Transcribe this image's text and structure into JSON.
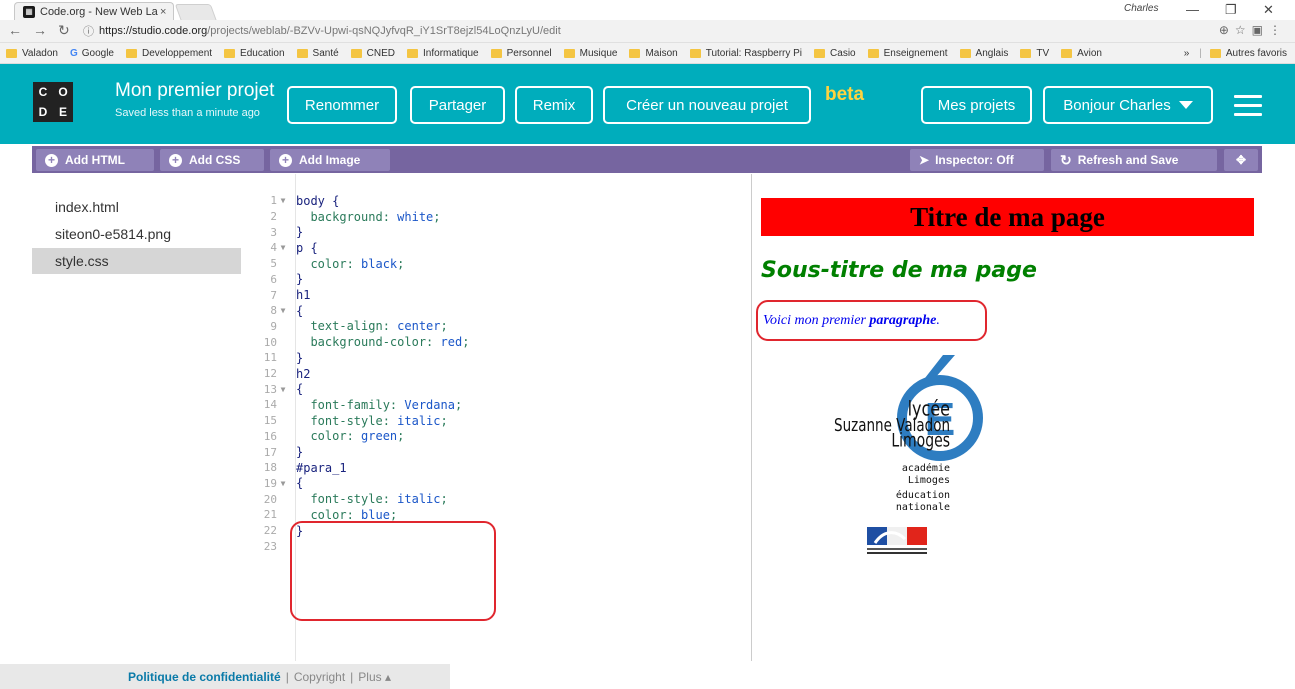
{
  "browser": {
    "tab_title": "Code.org - New Web Lab",
    "user": "Charles",
    "url_host": "https://studio.code.org",
    "url_path": "/projects/weblab/-BZVv-Upwi-qsNQJyfvqR_iY1SrT8ejzl54LoQnzLyU/edit",
    "bookmarks": [
      "Valadon",
      "Google",
      "Developpement",
      "Education",
      "Santé",
      "CNED",
      "Informatique",
      "Personnel",
      "Musique",
      "Maison",
      "Tutorial: Raspberry Pi",
      "Casio",
      "Enseignement",
      "Anglais",
      "TV",
      "Avion"
    ],
    "bookmarks_more": "»",
    "other_bookmarks": "Autres favoris"
  },
  "header": {
    "logo_letters": [
      "C",
      "O",
      "D",
      "E"
    ],
    "project_title": "Mon premier projet",
    "saved_status": "Saved less than a minute ago",
    "rename": "Renommer",
    "share": "Partager",
    "remix": "Remix",
    "new_project": "Créer un nouveau projet",
    "beta": "beta",
    "my_projects": "Mes projets",
    "greeting": "Bonjour Charles"
  },
  "toolbar": {
    "add_html": "Add HTML",
    "add_css": "Add CSS",
    "add_image": "Add Image",
    "inspector": "Inspector: Off",
    "refresh": "Refresh and Save"
  },
  "files": [
    "index.html",
    "siteon0-e5814.png",
    "style.css"
  ],
  "active_file": "style.css",
  "code_lines": [
    {
      "n": "1",
      "fold": true,
      "text": "body {"
    },
    {
      "n": "2",
      "fold": false,
      "text": "  background: white;"
    },
    {
      "n": "3",
      "fold": false,
      "text": "}"
    },
    {
      "n": "4",
      "fold": true,
      "text": "p {"
    },
    {
      "n": "5",
      "fold": false,
      "text": "  color: black;"
    },
    {
      "n": "6",
      "fold": false,
      "text": "}"
    },
    {
      "n": "7",
      "fold": false,
      "text": "h1"
    },
    {
      "n": "8",
      "fold": true,
      "text": "{"
    },
    {
      "n": "9",
      "fold": false,
      "text": "  text-align: center;"
    },
    {
      "n": "10",
      "fold": false,
      "text": "  background-color: red;"
    },
    {
      "n": "11",
      "fold": false,
      "text": "}"
    },
    {
      "n": "12",
      "fold": false,
      "text": "h2"
    },
    {
      "n": "13",
      "fold": true,
      "text": "{"
    },
    {
      "n": "14",
      "fold": false,
      "text": "  font-family: Verdana;"
    },
    {
      "n": "15",
      "fold": false,
      "text": "  font-style: italic;"
    },
    {
      "n": "16",
      "fold": false,
      "text": "  color: green;"
    },
    {
      "n": "17",
      "fold": false,
      "text": "}"
    },
    {
      "n": "18",
      "fold": false,
      "text": "#para_1"
    },
    {
      "n": "19",
      "fold": true,
      "text": "{"
    },
    {
      "n": "20",
      "fold": false,
      "text": "  font-style: italic;"
    },
    {
      "n": "21",
      "fold": false,
      "text": "  color: blue;"
    },
    {
      "n": "22",
      "fold": false,
      "text": "}"
    },
    {
      "n": "23",
      "fold": false,
      "text": ""
    }
  ],
  "preview": {
    "h1": "Titre de ma page",
    "h2": "Sous-titre de ma page",
    "para_prefix": "Voici mon premier ",
    "para_bold": "paragraphe",
    "para_suffix": ".",
    "school_lines": [
      "lycée",
      "Suzanne Valadon",
      "Limoges",
      "académie",
      "Limoges",
      "éducation",
      "nationale"
    ],
    "marianne_text": "Liberté • Égalité • Fraternité\nRÉPUBLIQUE FRANÇAISE"
  },
  "footer": {
    "privacy": "Politique de confidentialité",
    "copyright": "Copyright",
    "more": "Plus ▴"
  },
  "colors": {
    "header_bg": "#00adbc",
    "toolbar_bg": "#7665a0",
    "beta": "#ffd33f",
    "highlight": "#e0262e"
  }
}
